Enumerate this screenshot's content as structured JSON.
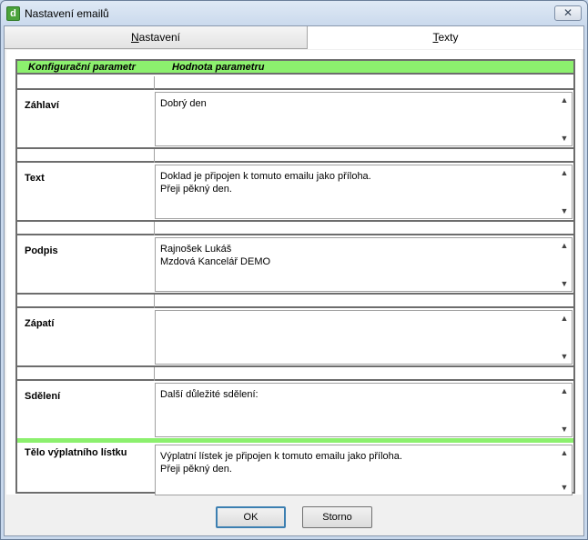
{
  "window": {
    "title": "Nastavení emailů",
    "close_glyph": "✕",
    "app_icon": "d"
  },
  "tabs": [
    {
      "label_pre": "",
      "label_ul": "N",
      "label_post": "astavení"
    },
    {
      "label_pre": "",
      "label_ul": "T",
      "label_post": "exty"
    }
  ],
  "grid": {
    "header": {
      "col1": "Konfigurační parametr",
      "col2": "Hodnota parametru"
    },
    "rows": [
      {
        "label": "Záhlaví",
        "value": "Dobrý den"
      },
      {
        "label": "Text",
        "value": "Doklad je připojen k tomuto emailu jako příloha.\nPřeji pěkný den."
      },
      {
        "label": "Podpis",
        "value": "Rajnošek Lukáš\nMzdová Kancelář DEMO"
      },
      {
        "label": "Zápatí",
        "value": ""
      },
      {
        "label": "Sdělení",
        "value": "Další důležité sdělení:"
      },
      {
        "label": "Tělo výplatního lístku",
        "value": "Výplatní lístek je připojen k tomuto emailu jako příloha.\nPřeji pěkný den."
      }
    ]
  },
  "buttons": {
    "ok": "OK",
    "storno": "Storno"
  },
  "icons": {
    "scroll_up": "chevron-up-icon",
    "scroll_down": "chevron-down-icon"
  }
}
